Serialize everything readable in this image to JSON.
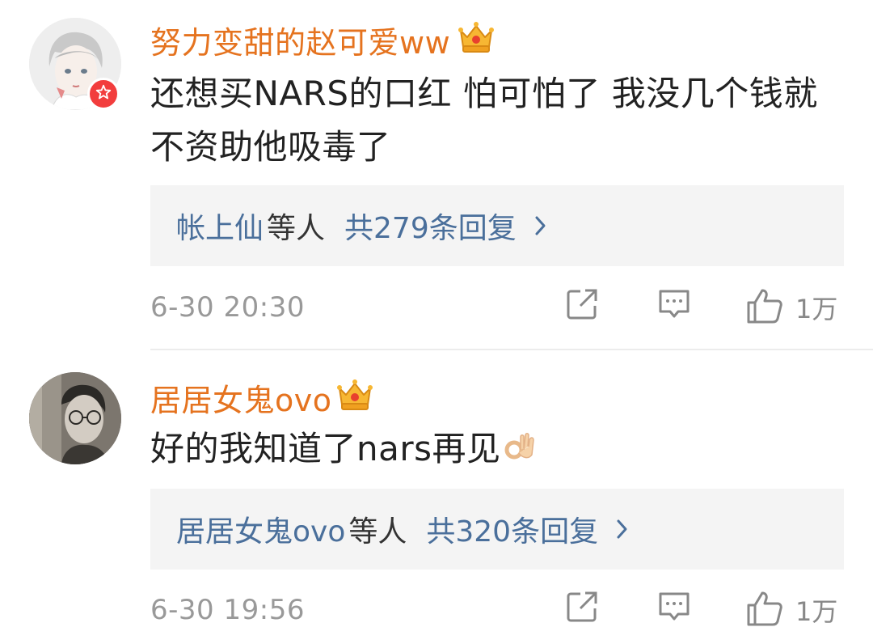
{
  "comments": [
    {
      "username": "努力变甜的赵可爱ww",
      "text": "还想买NARS的口红 怕可怕了 我没几个钱就不资助他吸毒了",
      "reply": {
        "names": "帐上仙",
        "suffix": "等人",
        "count": "共279条回复"
      },
      "timestamp": "6-30 20:30",
      "likes": "1万",
      "icons": {
        "avatar": "avatar-illustrated",
        "badge": "verified-star-icon",
        "crown": "crown-icon"
      }
    },
    {
      "username": "居居女鬼ovo",
      "text": "好的我知道了nars再见",
      "reply": {
        "names": "居居女鬼ovo",
        "suffix": "等人",
        "count": "共320条回复"
      },
      "timestamp": "6-30 19:56",
      "likes": "1万",
      "icons": {
        "avatar": "avatar-photo",
        "crown": "crown-icon",
        "emoji": "ok-hand-emoji"
      }
    }
  ],
  "colors": {
    "username": "#e5731f",
    "reply_link": "#4a6f9b",
    "reply_bg": "#f4f4f4",
    "meta": "#999999",
    "badge": "#f23d3d"
  }
}
